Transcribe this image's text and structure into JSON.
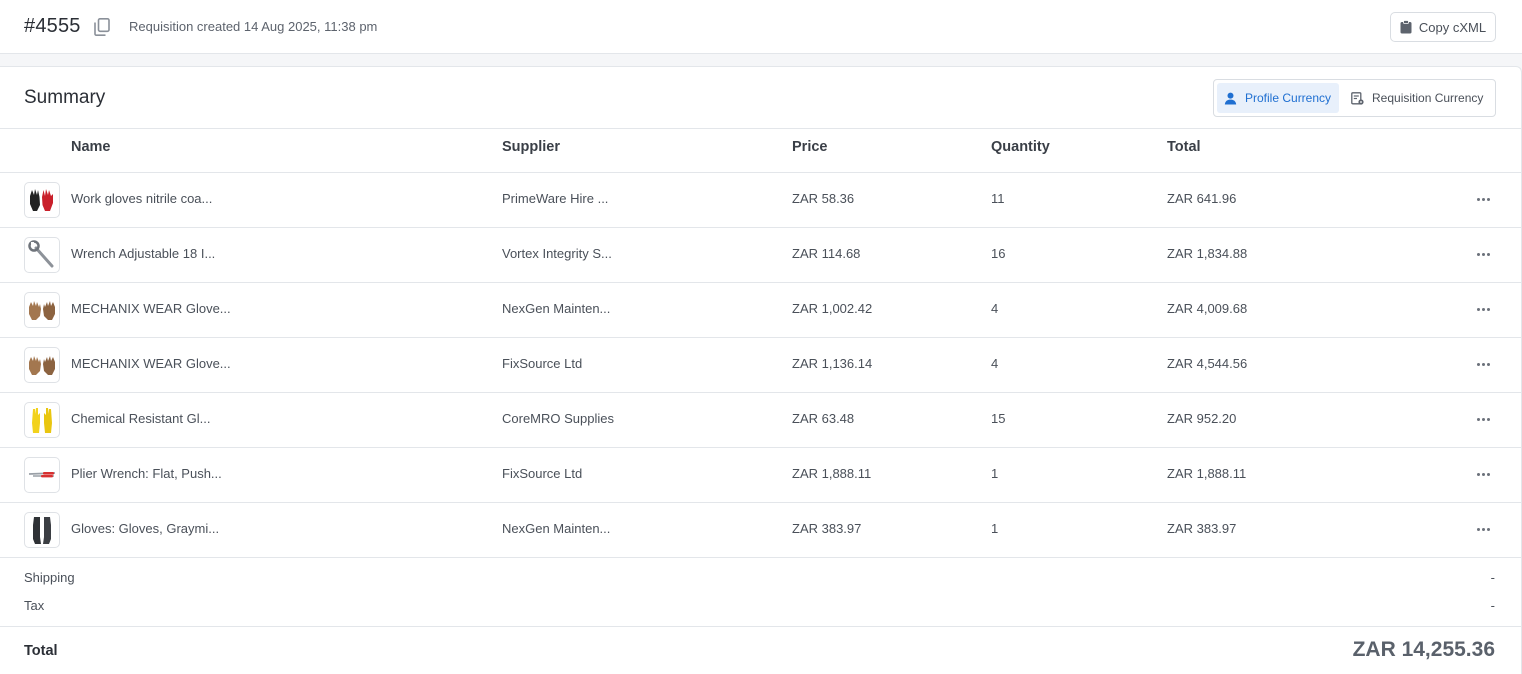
{
  "header": {
    "requisition_id": "#4555",
    "created_text": "Requisition created 14 Aug 2025, 11:38 pm",
    "copy_cxml_label": "Copy cXML"
  },
  "summary": {
    "title": "Summary",
    "currency_toggle": {
      "profile_label": "Profile Currency",
      "requisition_label": "Requisition Currency",
      "selected": "Profile Currency"
    }
  },
  "table": {
    "columns": [
      "Name",
      "Supplier",
      "Price",
      "Quantity",
      "Total"
    ],
    "rows": [
      {
        "name": "Work gloves nitrile coa...",
        "supplier": "PrimeWare Hire ...",
        "price": "ZAR 58.36",
        "quantity": "11",
        "total": "ZAR 641.96",
        "thumb": "red-black-gloves"
      },
      {
        "name": "Wrench Adjustable 18 I...",
        "supplier": "Vortex Integrity S...",
        "price": "ZAR 114.68",
        "quantity": "16",
        "total": "ZAR 1,834.88",
        "thumb": "adjustable-wrench"
      },
      {
        "name": "MECHANIX WEAR Glove...",
        "supplier": "NexGen Mainten...",
        "price": "ZAR 1,002.42",
        "quantity": "4",
        "total": "ZAR 4,009.68",
        "thumb": "brown-leather-gloves"
      },
      {
        "name": "MECHANIX WEAR Glove...",
        "supplier": "FixSource Ltd",
        "price": "ZAR 1,136.14",
        "quantity": "4",
        "total": "ZAR 4,544.56",
        "thumb": "brown-leather-gloves"
      },
      {
        "name": "Chemical Resistant Gl...",
        "supplier": "CoreMRO Supplies",
        "price": "ZAR 63.48",
        "quantity": "15",
        "total": "ZAR 952.20",
        "thumb": "yellow-rubber-gloves"
      },
      {
        "name": "Plier Wrench: Flat, Push...",
        "supplier": "FixSource Ltd",
        "price": "ZAR 1,888.11",
        "quantity": "1",
        "total": "ZAR 1,888.11",
        "thumb": "plier-wrench"
      },
      {
        "name": "Gloves: Gloves, Graymi...",
        "supplier": "NexGen Mainten...",
        "price": "ZAR 383.97",
        "quantity": "1",
        "total": "ZAR 383.97",
        "thumb": "black-long-gloves"
      }
    ]
  },
  "footer": {
    "shipping_label": "Shipping",
    "shipping_value": "-",
    "tax_label": "Tax",
    "tax_value": "-",
    "total_label": "Total",
    "total_value": "ZAR 14,255.36"
  }
}
